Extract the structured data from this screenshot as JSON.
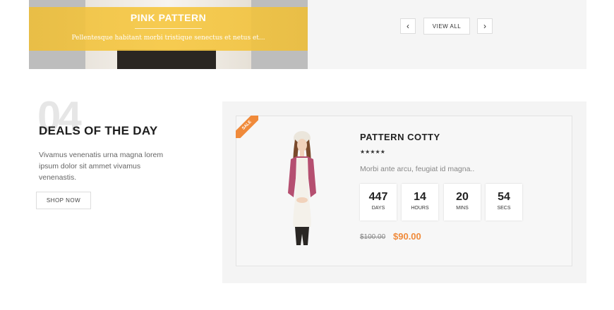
{
  "banner": {
    "title": "PINK PATTERN",
    "description": "Pellentesque habitant morbi tristique senectus et netus et..."
  },
  "pager": {
    "prev_icon": "chevron-left-icon",
    "next_icon": "chevron-right-icon",
    "prev_glyph": "‹",
    "next_glyph": "›",
    "view_all_label": "VIEW ALL"
  },
  "deals": {
    "number": "04",
    "title": "DEALS OF THE DAY",
    "text": "Vivamus venenatis urna magna lorem ipsum dolor sit ammet vivamus venenastis.",
    "shop_now_label": "SHOP NOW"
  },
  "product": {
    "sale_badge": "SALE",
    "name": "PATTERN COTTY",
    "rating": 5,
    "stars": "★★★★★",
    "description": "Morbi ante arcu, feugiat id magna..",
    "countdown": [
      {
        "value": "447",
        "unit": "DAYS"
      },
      {
        "value": "14",
        "unit": "HOURS"
      },
      {
        "value": "20",
        "unit": "MINS"
      },
      {
        "value": "54",
        "unit": "SECS"
      }
    ],
    "old_price": "$100.00",
    "new_price": "$90.00"
  },
  "colors": {
    "accent": "#f08a3a",
    "banner_overlay": "#f6c948"
  }
}
